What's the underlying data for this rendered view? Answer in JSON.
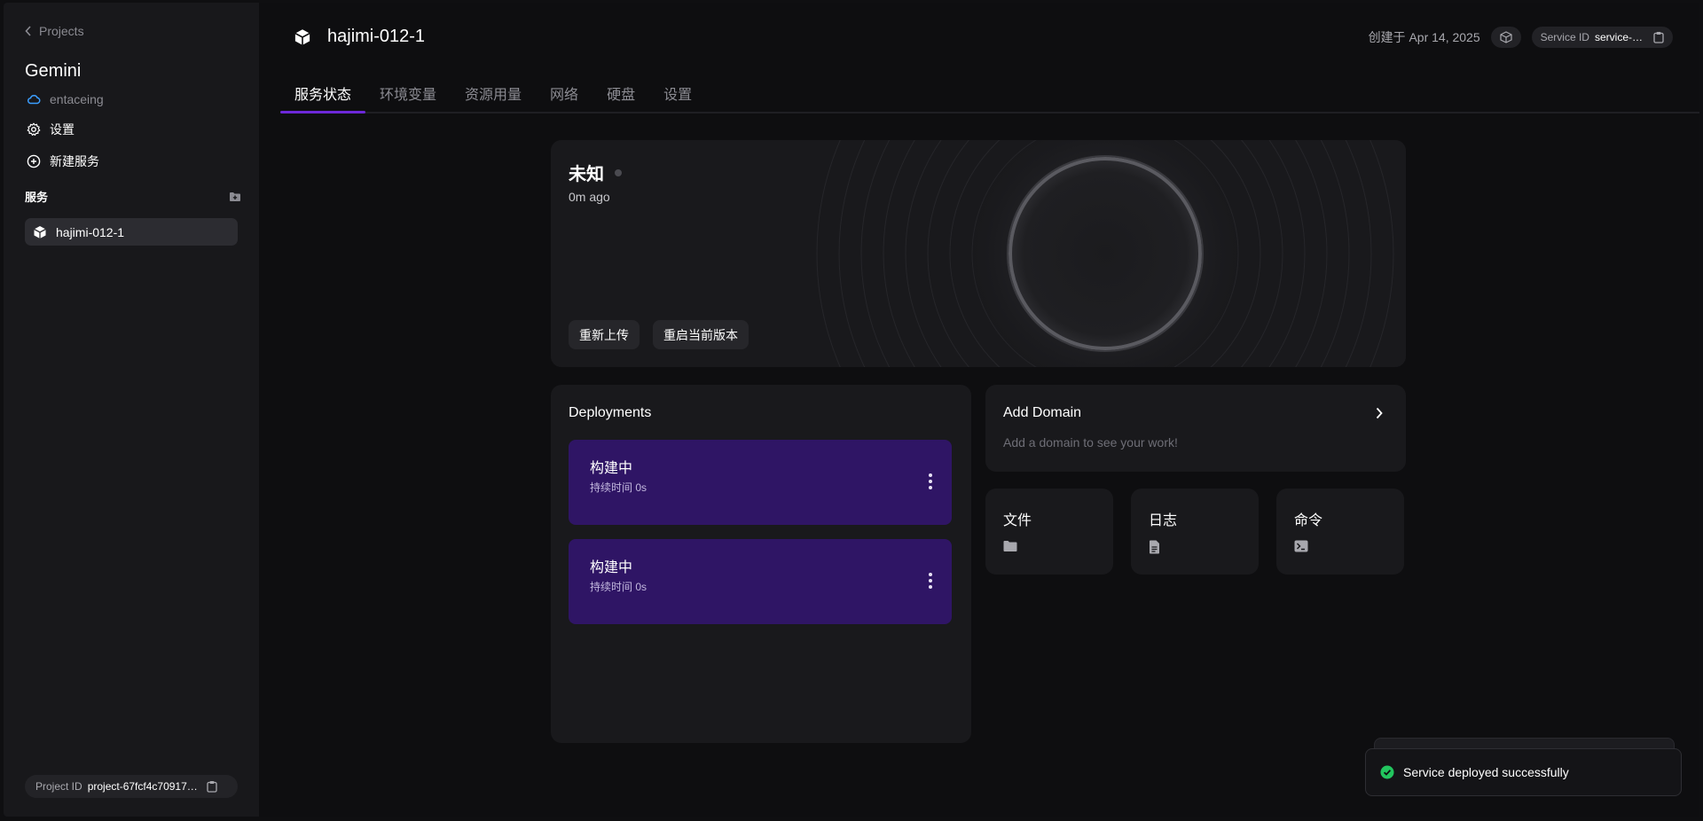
{
  "sidebar": {
    "back_label": "Projects",
    "project_name": "Gemini",
    "workspace": "entaceing",
    "settings_label": "设置",
    "new_service_label": "新建服务",
    "services_heading": "服务",
    "services": [
      {
        "name": "hajimi-012-1"
      }
    ],
    "project_id_label": "Project ID",
    "project_id_value": "project-67fcf4c70917…"
  },
  "header": {
    "service_name": "hajimi-012-1",
    "created": "创建于 Apr 14, 2025",
    "service_id_label": "Service ID",
    "service_id_value": "service-…"
  },
  "tabs": [
    {
      "label": "服务状态",
      "active": true
    },
    {
      "label": "环境变量"
    },
    {
      "label": "资源用量"
    },
    {
      "label": "网络"
    },
    {
      "label": "硬盘"
    },
    {
      "label": "设置"
    }
  ],
  "status": {
    "title": "未知",
    "time": "0m ago",
    "reupload_label": "重新上传",
    "restart_label": "重启当前版本"
  },
  "deployments": {
    "heading": "Deployments",
    "items": [
      {
        "title": "构建中",
        "subtitle": "持续时间 0s"
      },
      {
        "title": "构建中",
        "subtitle": "持续时间 0s"
      }
    ]
  },
  "domain": {
    "title": "Add Domain",
    "subtitle": "Add a domain to see your work!"
  },
  "quick_links": [
    {
      "label": "文件",
      "icon": "folder-icon"
    },
    {
      "label": "日志",
      "icon": "file-icon"
    },
    {
      "label": "命令",
      "icon": "terminal-icon"
    }
  ],
  "toast": {
    "message": "Service deployed successfully",
    "color": "#22c55e"
  },
  "colors": {
    "accent": "#6d28d9",
    "deploy_item": "#2f1565"
  }
}
